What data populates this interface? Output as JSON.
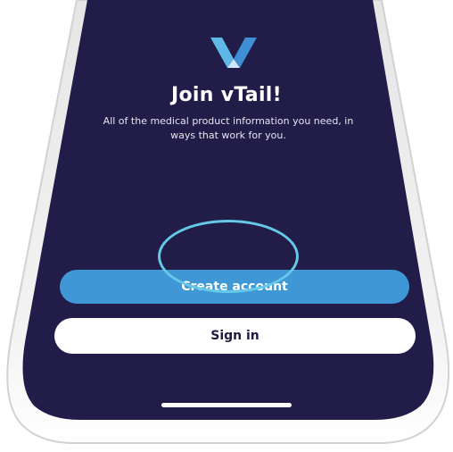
{
  "app": {
    "name": "vTail",
    "logo_icon": "vtail-logo-icon"
  },
  "welcome": {
    "title": "Join vTail!",
    "subtitle": "All of the medical product information you need, in ways that work for you."
  },
  "actions": {
    "create_account_label": "Create account",
    "sign_in_label": "Sign in"
  },
  "colors": {
    "screen_background": "#211c48",
    "primary_button": "#3f97d6",
    "secondary_button": "#ffffff",
    "tap_highlight": "#65c8e8"
  }
}
